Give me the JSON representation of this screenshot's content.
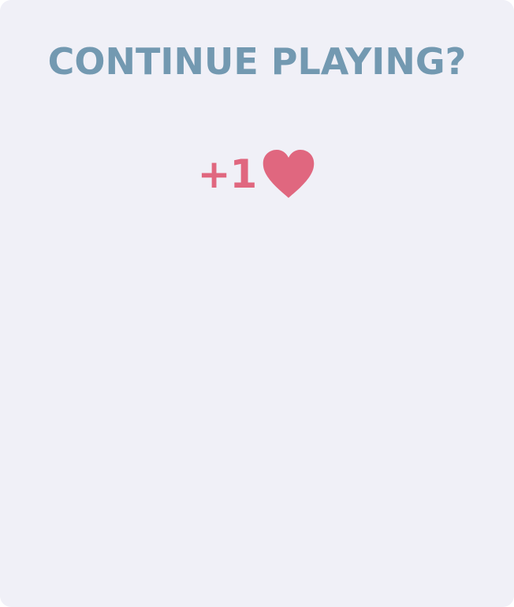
{
  "dialog": {
    "title": "CONTINUE PLAYING?",
    "reward": {
      "amount_text": "+1",
      "icon": "heart-icon"
    }
  },
  "colors": {
    "background": "#f0f0f7",
    "title": "#7399b1",
    "reward": "#e0677f"
  }
}
